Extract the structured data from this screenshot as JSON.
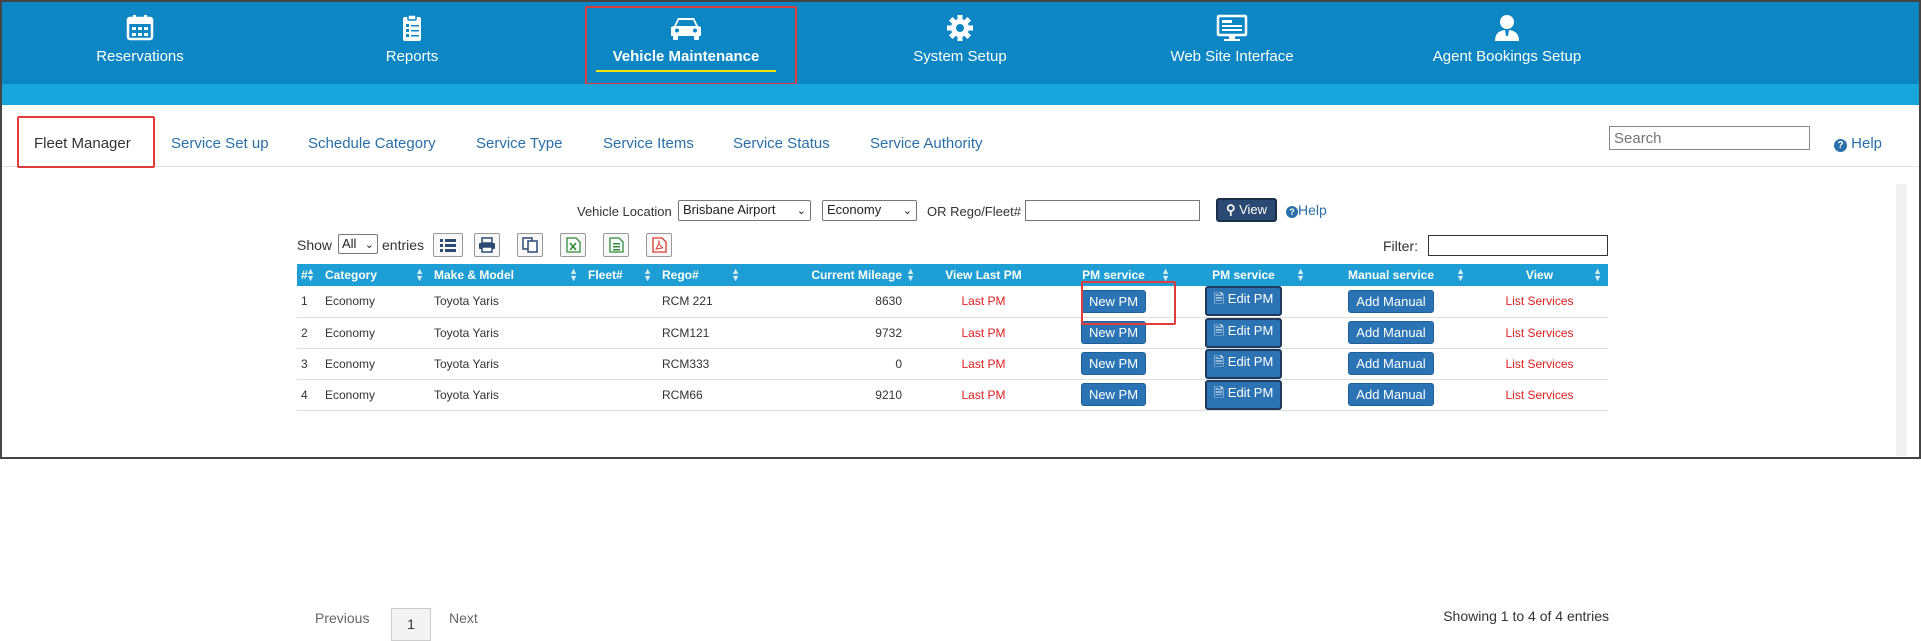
{
  "topnav": {
    "items": [
      {
        "label": "Reservations",
        "icon": "calendar-icon"
      },
      {
        "label": "Reports",
        "icon": "clipboard-icon"
      },
      {
        "label": "Vehicle Maintenance",
        "icon": "car-icon"
      },
      {
        "label": "System Setup",
        "icon": "gear-icon"
      },
      {
        "label": "Web Site Interface",
        "icon": "monitor-icon"
      },
      {
        "label": "Agent Bookings Setup",
        "icon": "agent-icon"
      }
    ],
    "active": "Vehicle Maintenance"
  },
  "subnav": {
    "items": [
      "Fleet Manager",
      "Service Set up",
      "Schedule Category",
      "Service Type",
      "Service Items",
      "Service Status",
      "Service Authority"
    ],
    "active": "Fleet Manager",
    "search_placeholder": "Search",
    "help_label": "Help"
  },
  "filters": {
    "vehicle_location_label": "Vehicle Location",
    "vehicle_location_value": "Brisbane Airport",
    "category_value": "Economy",
    "rego_label": "OR Rego/Fleet#",
    "rego_value": "",
    "view_button": "View",
    "help_label": "Help"
  },
  "table_controls": {
    "show_label": "Show",
    "show_value": "All",
    "entries_label": "entries",
    "filter_label": "Filter:",
    "filter_value": ""
  },
  "table": {
    "columns": [
      "#",
      "Category",
      "Make & Model",
      "Fleet#",
      "Rego#",
      "Current Mileage",
      "View Last PM",
      "PM service",
      "PM service",
      "Manual service",
      "View"
    ],
    "rows": [
      {
        "num": "1",
        "category": "Economy",
        "make_model": "Toyota Yaris",
        "fleet": "",
        "rego": "RCM 221",
        "mileage": "8630",
        "last_pm": "Last PM",
        "new_pm": "New PM",
        "edit_pm": "Edit PM",
        "add_manual": "Add Manual",
        "list_services": "List Services"
      },
      {
        "num": "2",
        "category": "Economy",
        "make_model": "Toyota Yaris",
        "fleet": "",
        "rego": "RCM121",
        "mileage": "9732",
        "last_pm": "Last PM",
        "new_pm": "New PM",
        "edit_pm": "Edit PM",
        "add_manual": "Add Manual",
        "list_services": "List Services"
      },
      {
        "num": "3",
        "category": "Economy",
        "make_model": "Toyota Yaris",
        "fleet": "",
        "rego": "RCM333",
        "mileage": "0",
        "last_pm": "Last PM",
        "new_pm": "New PM",
        "edit_pm": "Edit PM",
        "add_manual": "Add Manual",
        "list_services": "List Services"
      },
      {
        "num": "4",
        "category": "Economy",
        "make_model": "Toyota Yaris",
        "fleet": "",
        "rego": "RCM66",
        "mileage": "9210",
        "last_pm": "Last PM",
        "new_pm": "New PM",
        "edit_pm": "Edit PM",
        "add_manual": "Add Manual",
        "list_services": "List Services"
      }
    ]
  },
  "pagination": {
    "previous": "Previous",
    "page": "1",
    "next": "Next",
    "summary": "Showing 1 to 4 of 4 entries"
  },
  "colors": {
    "nav_bg": "#0c87c4",
    "stripe": "#18a5dc",
    "table_header": "#1d9ed4",
    "highlight_box": "#e03c3c",
    "link": "#2a6fa8"
  }
}
